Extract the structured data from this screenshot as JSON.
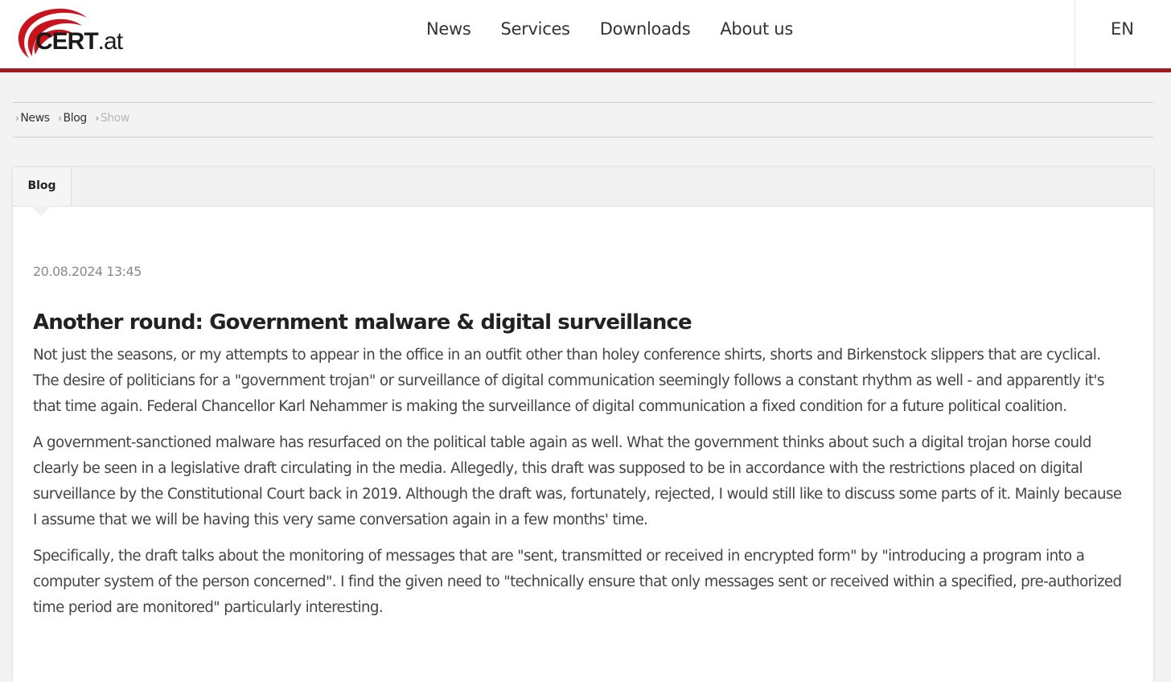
{
  "header": {
    "logo": {
      "brand": "CERT",
      "tld": ".at"
    },
    "nav": [
      "News",
      "Services",
      "Downloads",
      "About us"
    ],
    "language": "EN"
  },
  "breadcrumb": {
    "items": [
      "News",
      "Blog"
    ],
    "current": "Show"
  },
  "tab": {
    "label": "Blog"
  },
  "article": {
    "date": "20.08.2024 13:45",
    "title": "Another round: Government malware & digital surveillance",
    "paragraphs": [
      "Not just the seasons, or my attempts to appear in the office in an outfit other than holey conference shirts, shorts and Birkenstock slippers that are cyclical. The desire of politicians for a \"government trojan\" or surveillance of digital communication seemingly follows a constant rhythm as well - and apparently it's that time again. Federal Chancellor Karl Nehammer is making the surveillance of digital communication a fixed condition for a future political coalition.",
      "A government-sanctioned malware has resurfaced on the political table again as well. What the government thinks about such a digital trojan horse could clearly be seen in a legislative draft circulating in the media. Allegedly, this draft was supposed to be in accordance with the restrictions placed on digital surveillance by the Constitutional Court back in 2019. Although the draft was, fortunately, rejected, I would still like to discuss some parts of it. Mainly because I assume that we will be having this very same conversation again in a few months' time.",
      "Specifically, the draft talks about the monitoring of messages that are \"sent, transmitted or received in encrypted form\" by \"introducing a program into a computer system of the person concerned\". I find the given need to \"technically ensure that only messages sent or received within a specified, pre-authorized time period are monitored\" particularly interesting."
    ]
  },
  "colors": {
    "accent": "#a3161d",
    "background": "#f3f3f3",
    "breadcrumb_current": "#b8b8b8"
  }
}
